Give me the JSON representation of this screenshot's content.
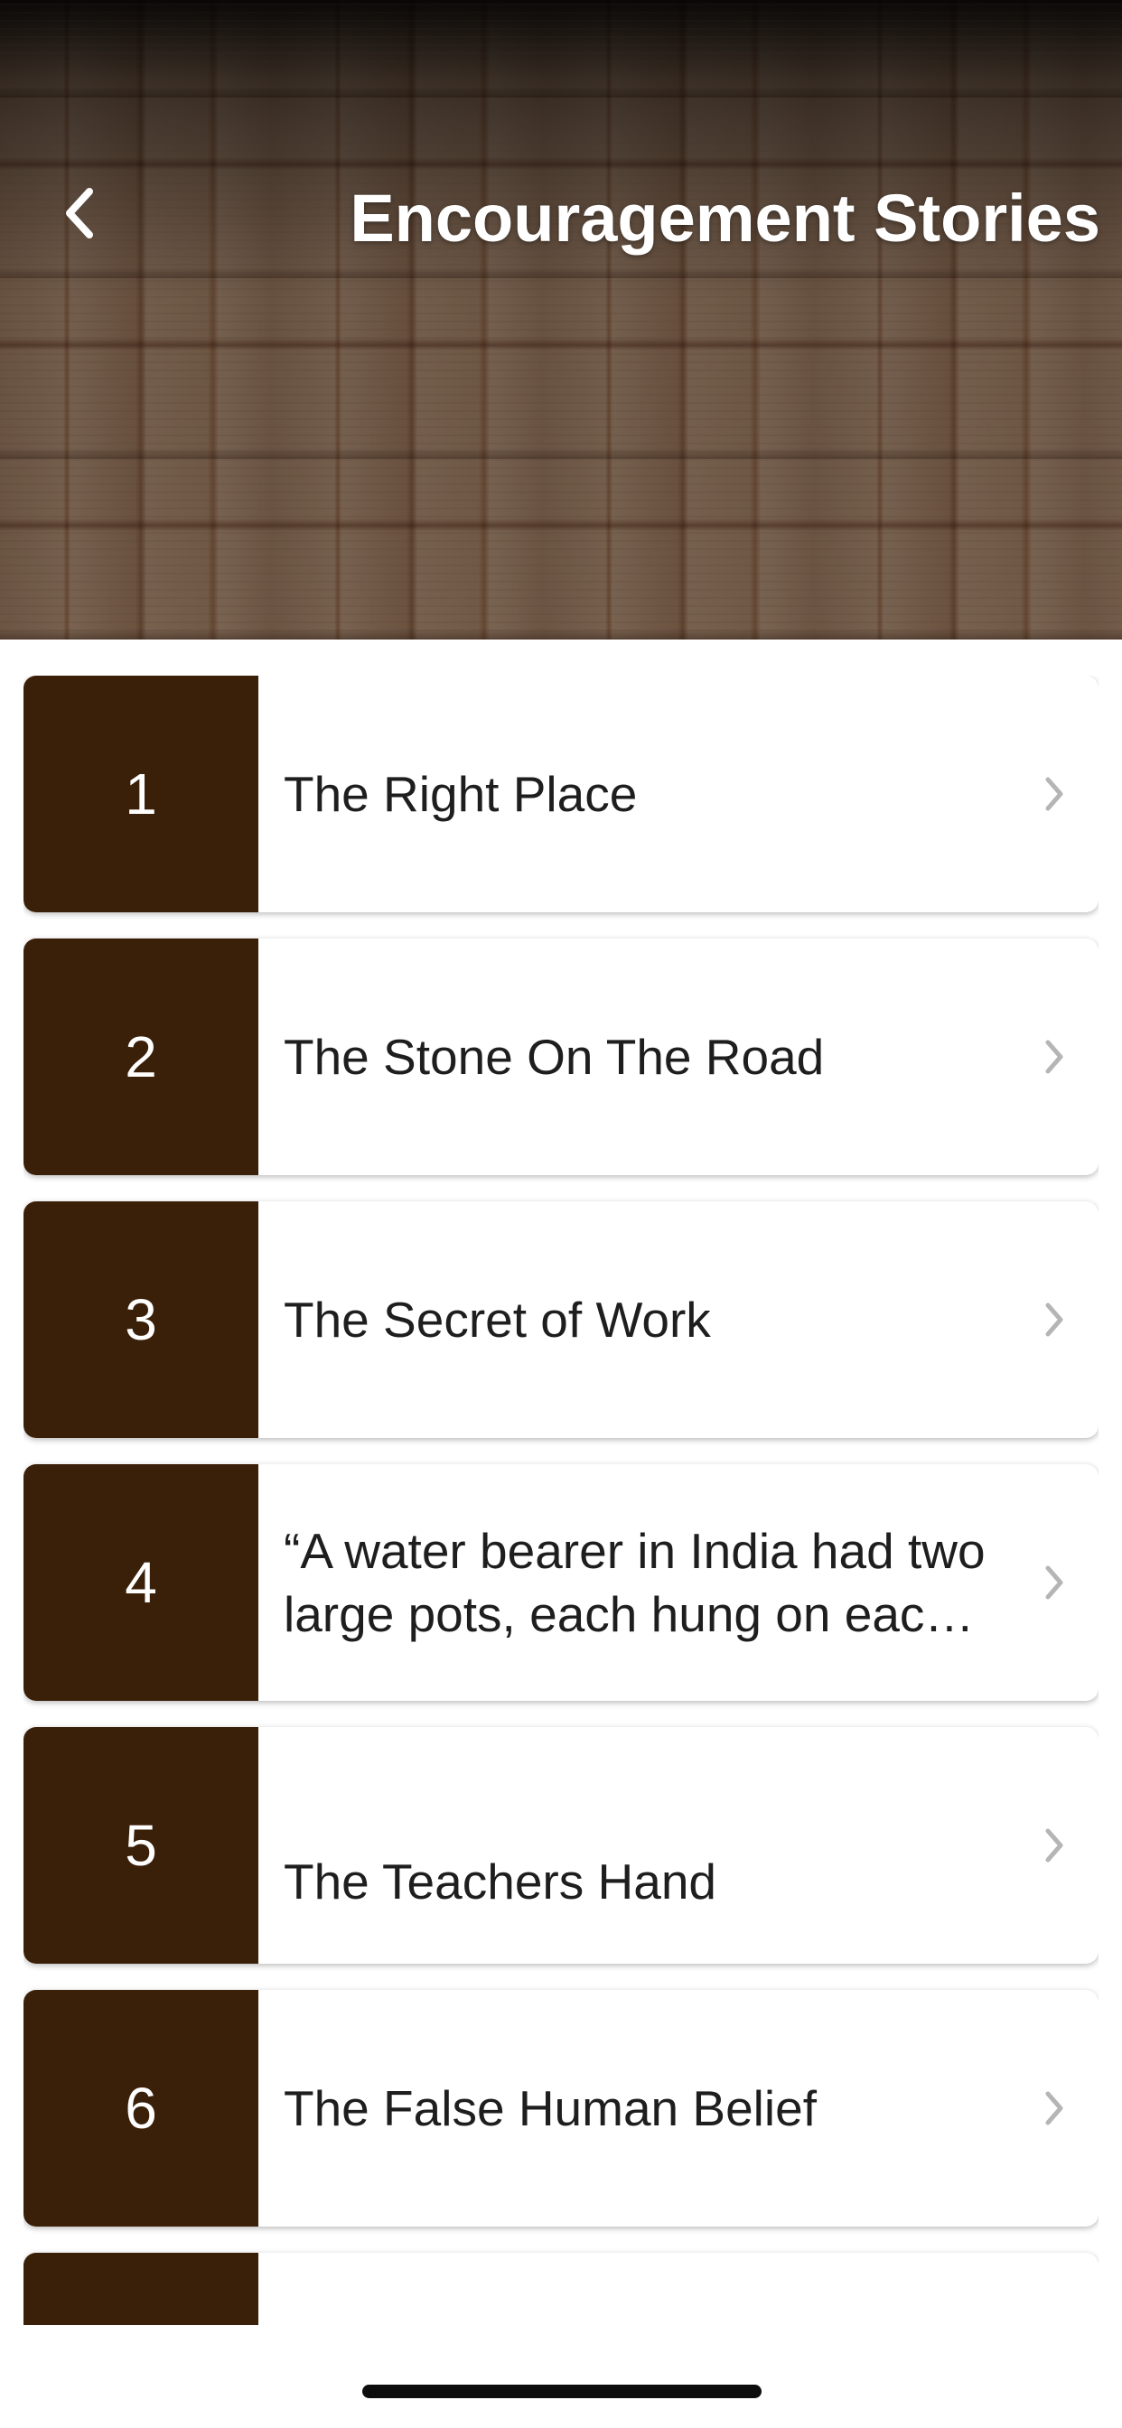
{
  "header": {
    "title": "Encouragement Stories",
    "back_icon": "chevron-left-icon"
  },
  "stories": [
    {
      "number": "1",
      "title": "The Right Place"
    },
    {
      "number": "2",
      "title": "The Stone On The Road"
    },
    {
      "number": "3",
      "title": "The Secret of Work"
    },
    {
      "number": "4",
      "title": "“A water bearer in India had two large pots, each hung on each end of a pole which he carried across his neck."
    },
    {
      "number": "5",
      "title": "The Teachers Hand"
    },
    {
      "number": "6",
      "title": "The False Human Belief"
    },
    {
      "number": "",
      "title": ""
    }
  ],
  "colors": {
    "number_box": "#3a1f09",
    "chevron": "#b5b5b5",
    "title_text": "#ffffff"
  }
}
